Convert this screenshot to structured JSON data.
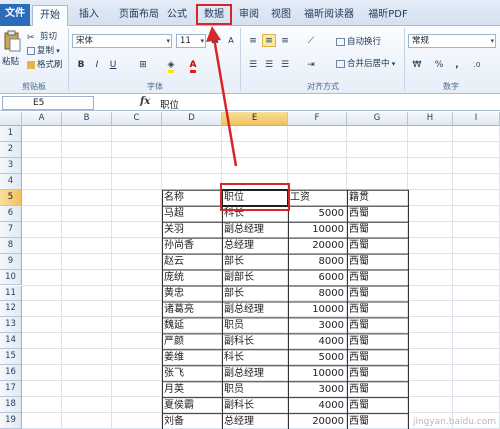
{
  "ribbon": {
    "tabs": [
      "文件",
      "开始",
      "插入",
      "页面布局",
      "公式",
      "数据",
      "审阅",
      "视图",
      "福昕阅读器",
      "福昕PDF"
    ],
    "clipboard": {
      "paste": "粘贴",
      "cut": "剪切",
      "copy": "复制",
      "format_painter": "格式刷",
      "label": "剪贴板"
    },
    "font": {
      "name": "宋体",
      "size": "11",
      "bold": "B",
      "italic": "I",
      "underline": "U",
      "grow": "A",
      "shrink": "A",
      "label": "字体"
    },
    "alignment": {
      "wrap_text": "自动换行",
      "merge_center": "合并后居中",
      "label": "对齐方式"
    },
    "number": {
      "format": "常规",
      "percent": "%",
      "comma": ",",
      "label": "数字"
    }
  },
  "formula_bar": {
    "name_box": "E5",
    "fx": "fx",
    "content": "职位"
  },
  "columns": [
    "A",
    "B",
    "C",
    "D",
    "E",
    "F",
    "G",
    "H",
    "I"
  ],
  "rows": [
    "1",
    "2",
    "3",
    "4",
    "5",
    "6",
    "7",
    "8",
    "9",
    "10",
    "11",
    "12",
    "13",
    "14",
    "15",
    "16",
    "17",
    "18",
    "19"
  ],
  "table": {
    "headers": [
      "名称",
      "职位",
      "工资",
      "籍贯"
    ],
    "records": [
      [
        "马超",
        "科长",
        "5000",
        "西蜀"
      ],
      [
        "关羽",
        "副总经理",
        "10000",
        "西蜀"
      ],
      [
        "孙尚香",
        "总经理",
        "20000",
        "西蜀"
      ],
      [
        "赵云",
        "部长",
        "8000",
        "西蜀"
      ],
      [
        "庞统",
        "副部长",
        "6000",
        "西蜀"
      ],
      [
        "黄忠",
        "部长",
        "8000",
        "西蜀"
      ],
      [
        "诸葛亮",
        "副总经理",
        "10000",
        "西蜀"
      ],
      [
        "魏延",
        "职员",
        "3000",
        "西蜀"
      ],
      [
        "严颜",
        "副科长",
        "4000",
        "西蜀"
      ],
      [
        "姜维",
        "科长",
        "5000",
        "西蜀"
      ],
      [
        "张飞",
        "副总经理",
        "10000",
        "西蜀"
      ],
      [
        "月英",
        "职员",
        "3000",
        "西蜀"
      ],
      [
        "夏侯霸",
        "副科长",
        "4000",
        "西蜀"
      ],
      [
        "刘备",
        "总经理",
        "20000",
        "西蜀"
      ]
    ]
  },
  "colors": {
    "highlight": "#d6262a",
    "selection": "#f1c15f",
    "ribbon": "#2a6cb8"
  }
}
